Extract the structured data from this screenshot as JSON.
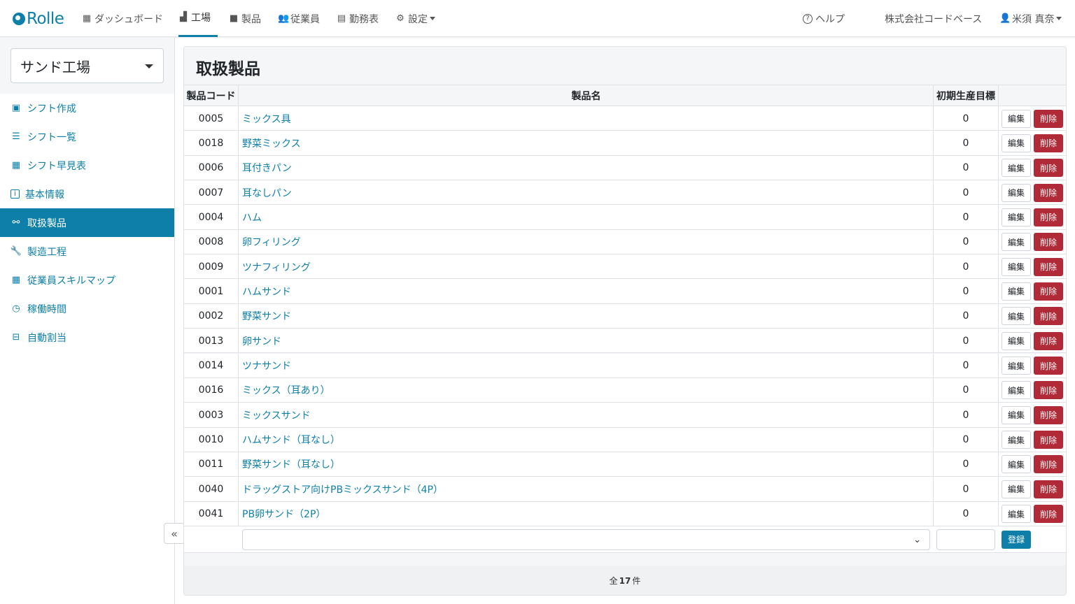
{
  "brand": {
    "name": "Rolle"
  },
  "nav": {
    "items": [
      {
        "label": "ダッシュボード",
        "icon": "calendar-icon"
      },
      {
        "label": "工場",
        "icon": "factory-icon"
      },
      {
        "label": "製品",
        "icon": "box-icon"
      },
      {
        "label": "従業員",
        "icon": "people-icon"
      },
      {
        "label": "勤務表",
        "icon": "document-icon"
      },
      {
        "label": "設定",
        "icon": "gear-icon"
      }
    ],
    "help": "ヘルプ",
    "company": "株式会社コードベース",
    "user": "米須 真奈"
  },
  "sidebar": {
    "factory": "サンド工場",
    "items": [
      {
        "label": "シフト作成",
        "icon": "calendar-plus-icon"
      },
      {
        "label": "シフト一覧",
        "icon": "list-icon"
      },
      {
        "label": "シフト早見表",
        "icon": "table-icon"
      },
      {
        "label": "基本情報",
        "icon": "info-icon"
      },
      {
        "label": "取扱製品",
        "icon": "boxes-icon"
      },
      {
        "label": "製造工程",
        "icon": "wrench-icon"
      },
      {
        "label": "従業員スキルマップ",
        "icon": "grid-icon"
      },
      {
        "label": "稼働時間",
        "icon": "clock-icon"
      },
      {
        "label": "自動割当",
        "icon": "robot-icon"
      }
    ],
    "active_index": 4
  },
  "main": {
    "title": "取扱製品",
    "columns": {
      "code": "製品コード",
      "name": "製品名",
      "target": "初期生産目標"
    },
    "rows": [
      {
        "code": "0005",
        "name": "ミックス具",
        "target": "0"
      },
      {
        "code": "0018",
        "name": "野菜ミックス",
        "target": "0"
      },
      {
        "code": "0006",
        "name": "耳付きパン",
        "target": "0"
      },
      {
        "code": "0007",
        "name": "耳なしパン",
        "target": "0"
      },
      {
        "code": "0004",
        "name": "ハム",
        "target": "0"
      },
      {
        "code": "0008",
        "name": "卵フィリング",
        "target": "0"
      },
      {
        "code": "0009",
        "name": "ツナフィリング",
        "target": "0"
      },
      {
        "code": "0001",
        "name": "ハムサンド",
        "target": "0"
      },
      {
        "code": "0002",
        "name": "野菜サンド",
        "target": "0"
      },
      {
        "code": "0013",
        "name": "卵サンド",
        "target": "0"
      },
      {
        "code": "0014",
        "name": "ツナサンド",
        "target": "0"
      },
      {
        "code": "0016",
        "name": "ミックス（耳あり）",
        "target": "0"
      },
      {
        "code": "0003",
        "name": "ミックスサンド",
        "target": "0"
      },
      {
        "code": "0010",
        "name": "ハムサンド（耳なし）",
        "target": "0"
      },
      {
        "code": "0011",
        "name": "野菜サンド（耳なし）",
        "target": "0"
      },
      {
        "code": "0040",
        "name": "ドラッグストア向けPBミックスサンド（4P）",
        "target": "0"
      },
      {
        "code": "0041",
        "name": "PB卵サンド（2P）",
        "target": "0"
      }
    ],
    "edit_label": "編集",
    "delete_label": "削除",
    "register_label": "登録",
    "footer": {
      "prefix": "全",
      "count": "17",
      "suffix": "件"
    }
  },
  "colors": {
    "accent": "#0d7fa8",
    "danger": "#b02a37"
  }
}
